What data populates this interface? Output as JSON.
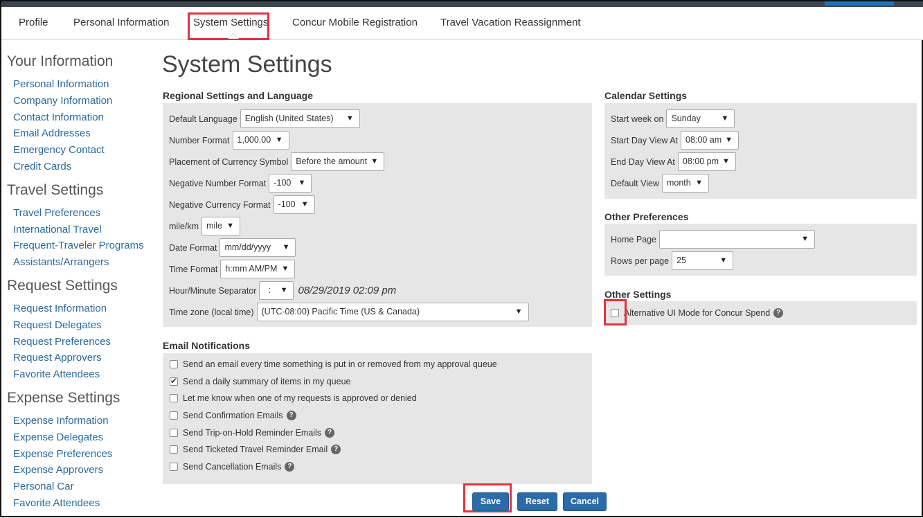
{
  "tabs": [
    "Profile",
    "Personal Information",
    "System Settings",
    "Concur Mobile Registration",
    "Travel Vacation Reassignment"
  ],
  "sidebar": {
    "groups": [
      {
        "heading": "Your Information",
        "items": [
          "Personal Information",
          "Company Information",
          "Contact Information",
          "Email Addresses",
          "Emergency Contact",
          "Credit Cards"
        ]
      },
      {
        "heading": "Travel Settings",
        "items": [
          "Travel Preferences",
          "International Travel",
          "Frequent-Traveler Programs",
          "Assistants/Arrangers"
        ]
      },
      {
        "heading": "Request Settings",
        "items": [
          "Request Information",
          "Request Delegates",
          "Request Preferences",
          "Request Approvers",
          "Favorite Attendees"
        ]
      },
      {
        "heading": "Expense Settings",
        "items": [
          "Expense Information",
          "Expense Delegates",
          "Expense Preferences",
          "Expense Approvers",
          "Personal Car",
          "Favorite Attendees"
        ]
      }
    ]
  },
  "page_title": "System Settings",
  "regional": {
    "title": "Regional Settings and Language",
    "default_language": {
      "label": "Default Language",
      "value": "English (United States)"
    },
    "number_format": {
      "label": "Number Format",
      "value": "1,000.00"
    },
    "currency_symbol": {
      "label": "Placement of Currency Symbol",
      "value": "Before the amount"
    },
    "negative_number": {
      "label": "Negative Number Format",
      "value": "-100"
    },
    "negative_currency": {
      "label": "Negative Currency Format",
      "value": "-100"
    },
    "mile_km": {
      "label": "mile/km",
      "value": "mile"
    },
    "date_format": {
      "label": "Date Format",
      "value": "mm/dd/yyyy"
    },
    "time_format": {
      "label": "Time Format",
      "value": "h:mm AM/PM"
    },
    "separator": {
      "label": "Hour/Minute Separator",
      "value": ":",
      "preview": "08/29/2019 02:09 pm"
    },
    "timezone": {
      "label": "Time zone (local time)",
      "value": "(UTC-08:00) Pacific Time (US & Canada)"
    }
  },
  "email": {
    "title": "Email Notifications",
    "items": [
      {
        "label": "Send an email every time something is put in or removed from my approval queue",
        "checked": false,
        "help": false
      },
      {
        "label": "Send a daily summary of items in my queue",
        "checked": true,
        "help": false
      },
      {
        "label": "Let me know when one of my requests is approved or denied",
        "checked": false,
        "help": false
      },
      {
        "label": "Send Confirmation Emails",
        "checked": false,
        "help": true
      },
      {
        "label": "Send Trip-on-Hold Reminder Emails",
        "checked": false,
        "help": true
      },
      {
        "label": "Send Ticketed Travel Reminder Email",
        "checked": false,
        "help": true
      },
      {
        "label": "Send Cancellation Emails",
        "checked": false,
        "help": true
      }
    ]
  },
  "calendar": {
    "title": "Calendar Settings",
    "start_week": {
      "label": "Start week on",
      "value": "Sunday"
    },
    "start_day": {
      "label": "Start Day View At",
      "value": "08:00 am"
    },
    "end_day": {
      "label": "End Day View At",
      "value": "08:00 pm"
    },
    "default_view": {
      "label": "Default View",
      "value": "month"
    }
  },
  "other_prefs": {
    "title": "Other Preferences",
    "home_page": {
      "label": "Home Page",
      "value": ""
    },
    "rows_per_page": {
      "label": "Rows per page",
      "value": "25"
    }
  },
  "other_settings": {
    "title": "Other Settings",
    "alt_ui": {
      "label": "Alternative UI Mode for Concur Spend",
      "checked": false
    }
  },
  "buttons": {
    "save": "Save",
    "reset": "Reset",
    "cancel": "Cancel"
  },
  "icons": {
    "dropdown": "▼",
    "help": "?"
  },
  "colors": {
    "highlight": "#e2323b",
    "link": "#2a6a9e",
    "button": "#2a6ba8",
    "panel": "#e6e6e6"
  }
}
